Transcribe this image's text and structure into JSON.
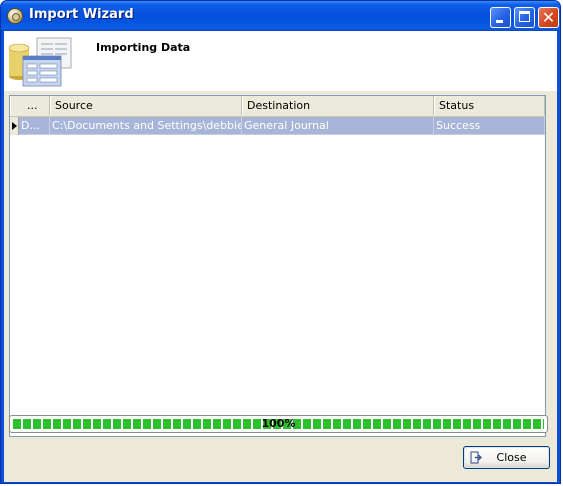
{
  "window": {
    "title": "Import Wizard"
  },
  "header": {
    "title": "Importing Data"
  },
  "grid": {
    "columns": [
      "...",
      "Source",
      "Destination",
      "Status"
    ],
    "rows": [
      {
        "col1": "D...",
        "source": "C:\\Documents and Settings\\debbie_...",
        "destination": "General Journal",
        "status": "Success"
      }
    ]
  },
  "progress": {
    "value": 1.0,
    "label": "100%",
    "color": "#2EBF2E"
  },
  "footer": {
    "close_label": "Close"
  },
  "colors": {
    "titlebar": "#0651E0",
    "selected_row": "#A7B5D8",
    "client": "#ECE9D8"
  }
}
